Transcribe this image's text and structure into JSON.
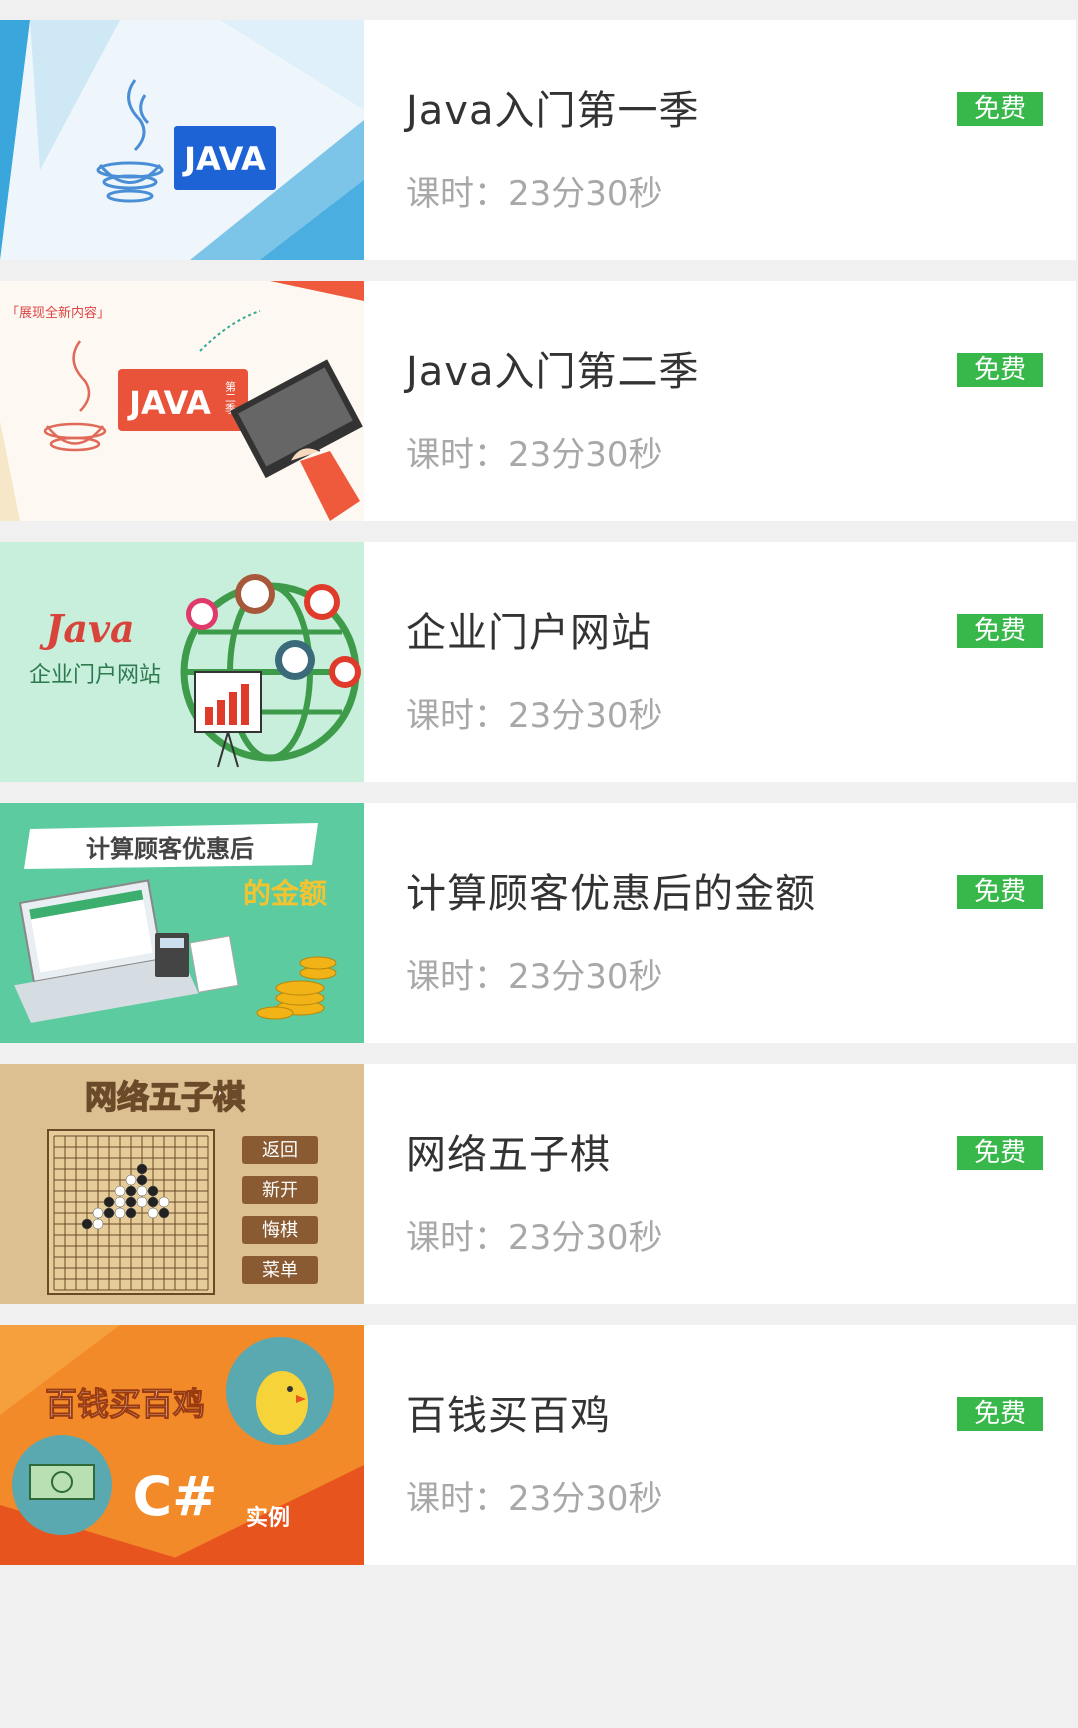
{
  "courses": [
    {
      "title": "Java入门第一季",
      "duration": "课时：23分30秒",
      "badge": "免费",
      "thumb_text": "JAVA"
    },
    {
      "title": "Java入门第二季",
      "duration": "课时：23分30秒",
      "badge": "免费",
      "thumb_text": "JAVA",
      "thumb_sub": "第二季",
      "thumb_tag": "「展现全新内容」"
    },
    {
      "title": "企业门户网站",
      "duration": "课时：23分30秒",
      "badge": "免费",
      "thumb_text": "Java",
      "thumb_sub": "企业门户网站"
    },
    {
      "title": "计算顾客优惠后的金额",
      "duration": "课时：23分30秒",
      "badge": "免费",
      "thumb_text": "计算顾客优惠后",
      "thumb_sub": "的金额"
    },
    {
      "title": "网络五子棋",
      "duration": "课时：23分30秒",
      "badge": "免费",
      "thumb_text": "网络五子棋",
      "thumb_buttons": [
        "返回",
        "新开",
        "悔棋",
        "菜单"
      ]
    },
    {
      "title": "百钱买百鸡",
      "duration": "课时：23分30秒",
      "badge": "免费",
      "thumb_text": "百钱买百鸡",
      "thumb_sub": "C#",
      "thumb_tag": "实例"
    }
  ],
  "colors": {
    "badge": "#38b84a",
    "title": "#333333",
    "duration": "#a8a8a8",
    "background": "#f0f0f0"
  }
}
